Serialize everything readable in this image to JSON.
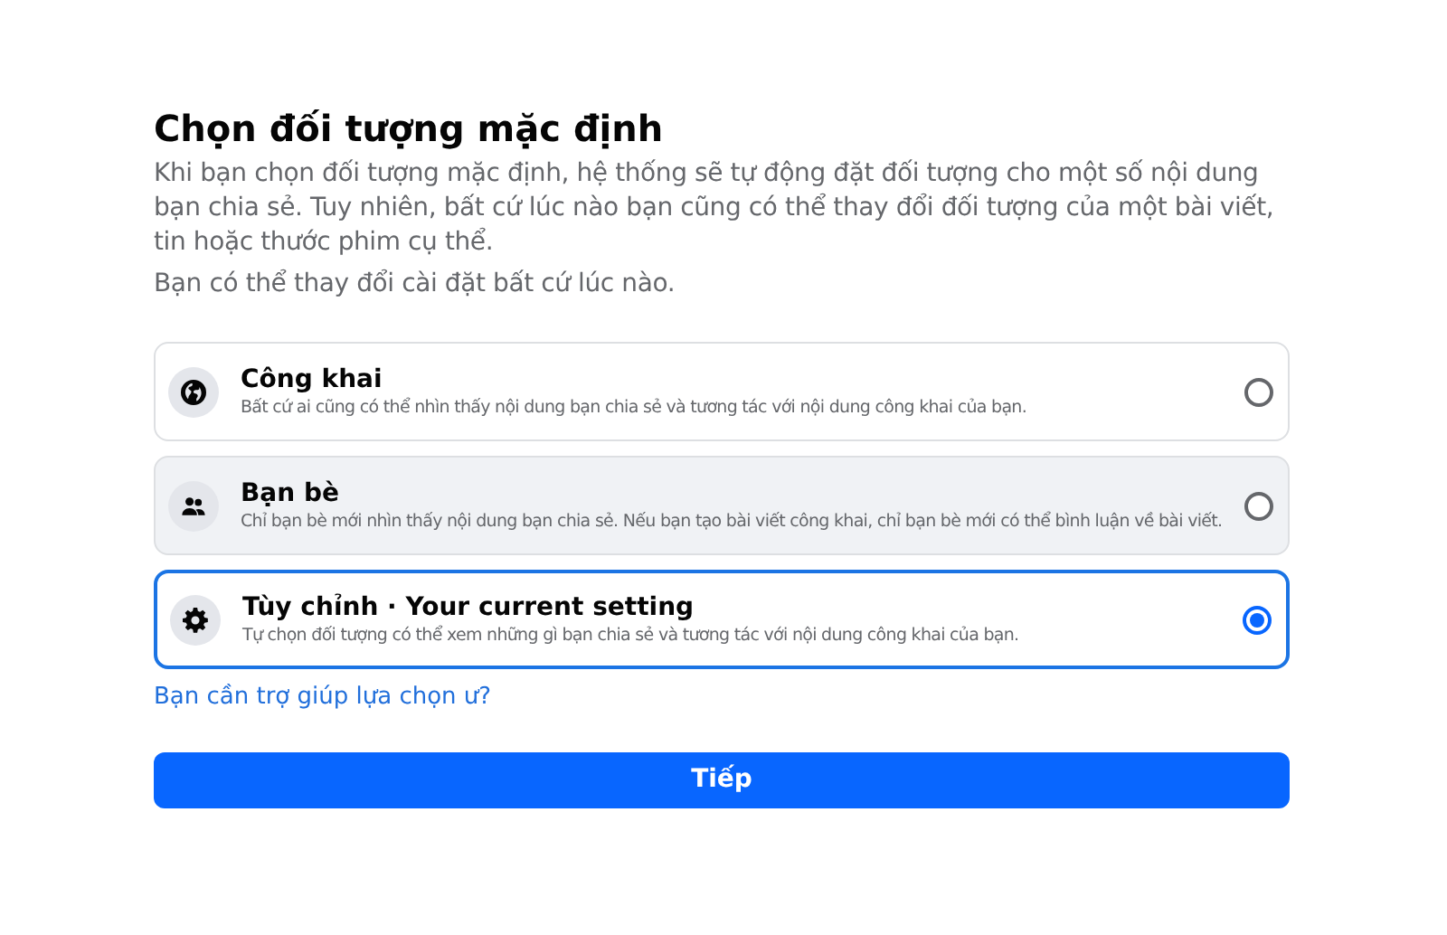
{
  "title": "Chọn đối tượng mặc định",
  "description": "Khi bạn chọn đối tượng mặc định, hệ thống sẽ tự động đặt đối tượng cho một số nội dung bạn chia sẻ. Tuy nhiên, bất cứ lúc nào bạn cũng có thể thay đổi đối tượng của một bài viết, tin hoặc thước phim cụ thể.",
  "note": "Bạn có thể thay đổi cài đặt bất cứ lúc nào.",
  "options": [
    {
      "kind": "public",
      "label": "Công khai",
      "detail": "Bất cứ ai cũng có thể nhìn thấy nội dung bạn chia sẻ và tương tác với nội dung công khai của bạn.",
      "selected": false,
      "hovered": false
    },
    {
      "kind": "friends",
      "label": "Bạn bè",
      "detail": "Chỉ bạn bè mới nhìn thấy nội dung bạn chia sẻ. Nếu bạn tạo bài viết công khai, chỉ bạn bè mới có thể bình luận về bài viết.",
      "selected": false,
      "hovered": true
    },
    {
      "kind": "custom",
      "label": "Tùy chỉnh · Your current setting",
      "detail": "Tự chọn đối tượng có thể xem những gì bạn chia sẻ và tương tác với nội dung công khai của bạn.",
      "selected": true,
      "hovered": false
    }
  ],
  "help_link": "Bạn cần trợ giúp lựa chọn ư?",
  "next_button": "Tiếp"
}
